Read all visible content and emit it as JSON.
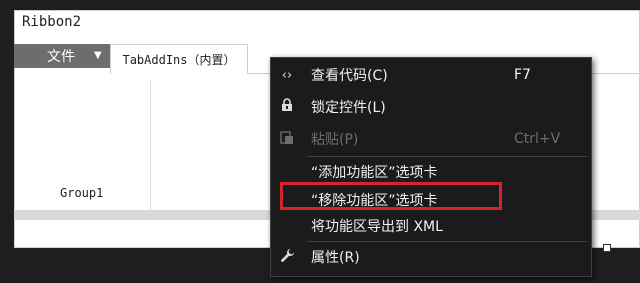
{
  "designer": {
    "title": "Ribbon2",
    "file_tab": "文件",
    "tab_addins": "TabAddIns（内置）",
    "group_label": "Group1"
  },
  "context_menu": {
    "items": [
      {
        "label": "查看代码(C)",
        "shortcut": "F7",
        "icon": "code-icon",
        "enabled": true
      },
      {
        "label": "锁定控件(L)",
        "shortcut": "",
        "icon": "lock-icon",
        "enabled": true
      },
      {
        "label": "粘贴(P)",
        "shortcut": "Ctrl+V",
        "icon": "paste-icon",
        "enabled": false
      },
      {
        "label": "“添加功能区”选项卡",
        "shortcut": "",
        "icon": "",
        "enabled": true
      },
      {
        "label": "“移除功能区”选项卡",
        "shortcut": "",
        "icon": "",
        "enabled": true
      },
      {
        "label": "将功能区导出到 XML",
        "shortcut": "",
        "icon": "",
        "enabled": true
      },
      {
        "label": "属性(R)",
        "shortcut": "",
        "icon": "wrench-icon",
        "enabled": true
      }
    ]
  },
  "colors": {
    "menu_bg": "#1b1b1c",
    "highlight_border": "#d2252c",
    "file_tab_bg": "#6d6d6d"
  }
}
